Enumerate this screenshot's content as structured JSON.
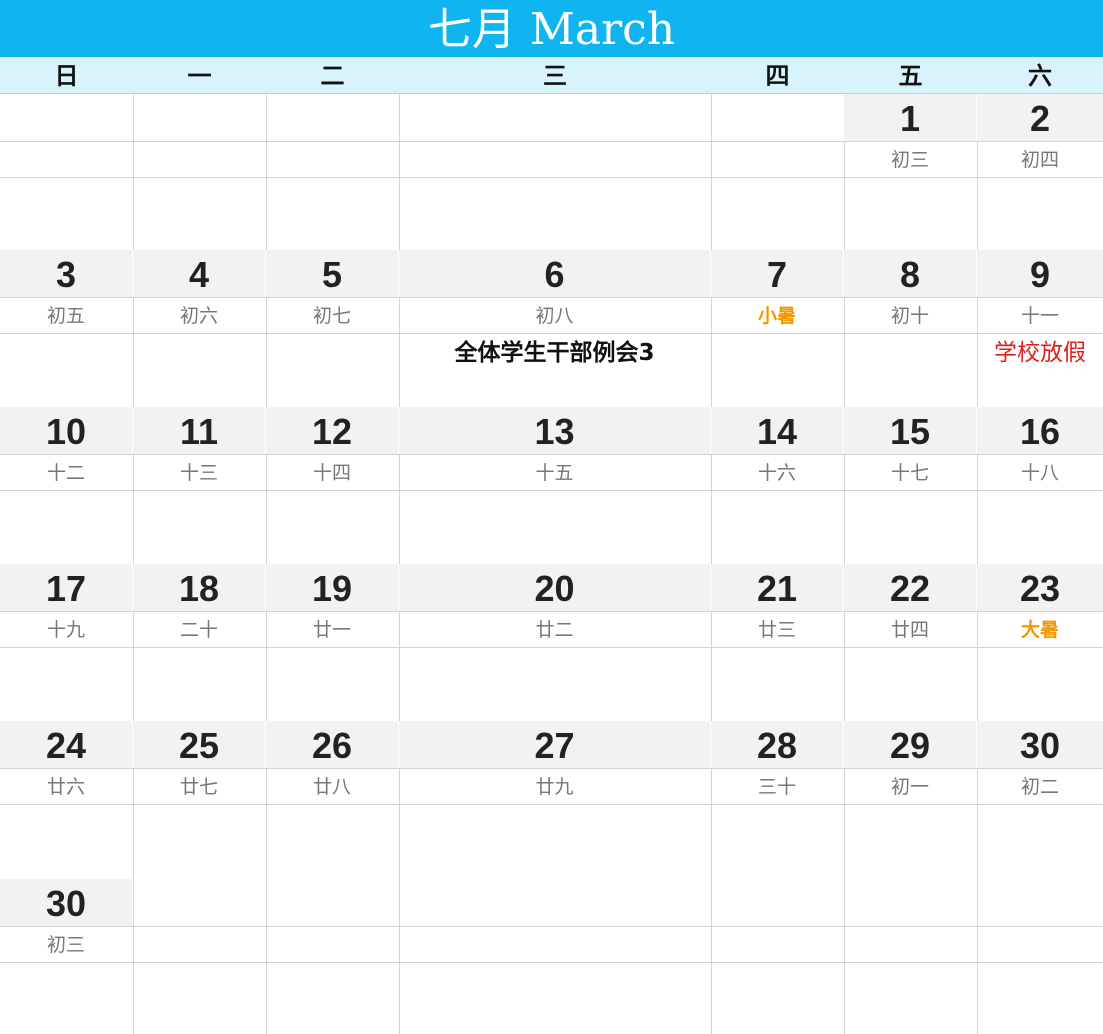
{
  "title": "七月 March",
  "weekdays": [
    "日",
    "一",
    "二",
    "三",
    "四",
    "五",
    "六"
  ],
  "colors": {
    "header_bg": "#10b4f0",
    "weekday_bg": "#d8f3fc",
    "date_bg": "#f2f2f2",
    "solar_term": "#f39800",
    "holiday": "#e0201e"
  },
  "weeks": [
    [
      null,
      null,
      null,
      null,
      null,
      {
        "day": "1",
        "lunar": "初三"
      },
      {
        "day": "2",
        "lunar": "初四"
      }
    ],
    [
      {
        "day": "3",
        "lunar": "初五"
      },
      {
        "day": "4",
        "lunar": "初六"
      },
      {
        "day": "5",
        "lunar": "初七"
      },
      {
        "day": "6",
        "lunar": "初八",
        "event": "全体学生干部例会3",
        "event_style": "bold"
      },
      {
        "day": "7",
        "lunar": "小暑",
        "lunar_type": "term"
      },
      {
        "day": "8",
        "lunar": "初十"
      },
      {
        "day": "9",
        "lunar": "十一",
        "event": "学校放假",
        "event_style": "red"
      }
    ],
    [
      {
        "day": "10",
        "lunar": "十二"
      },
      {
        "day": "11",
        "lunar": "十三"
      },
      {
        "day": "12",
        "lunar": "十四"
      },
      {
        "day": "13",
        "lunar": "十五"
      },
      {
        "day": "14",
        "lunar": "十六"
      },
      {
        "day": "15",
        "lunar": "十七"
      },
      {
        "day": "16",
        "lunar": "十八"
      }
    ],
    [
      {
        "day": "17",
        "lunar": "十九"
      },
      {
        "day": "18",
        "lunar": "二十"
      },
      {
        "day": "19",
        "lunar": "廿一"
      },
      {
        "day": "20",
        "lunar": "廿二"
      },
      {
        "day": "21",
        "lunar": "廿三"
      },
      {
        "day": "22",
        "lunar": "廿四"
      },
      {
        "day": "23",
        "lunar": "大暑",
        "lunar_type": "term"
      }
    ],
    [
      {
        "day": "24",
        "lunar": "廿六"
      },
      {
        "day": "25",
        "lunar": "廿七"
      },
      {
        "day": "26",
        "lunar": "廿八"
      },
      {
        "day": "27",
        "lunar": "廿九"
      },
      {
        "day": "28",
        "lunar": "三十"
      },
      {
        "day": "29",
        "lunar": "初一"
      },
      {
        "day": "30",
        "lunar": "初二"
      }
    ],
    [
      {
        "day": "30",
        "lunar": "初三"
      },
      null,
      null,
      null,
      null,
      null,
      null
    ]
  ]
}
